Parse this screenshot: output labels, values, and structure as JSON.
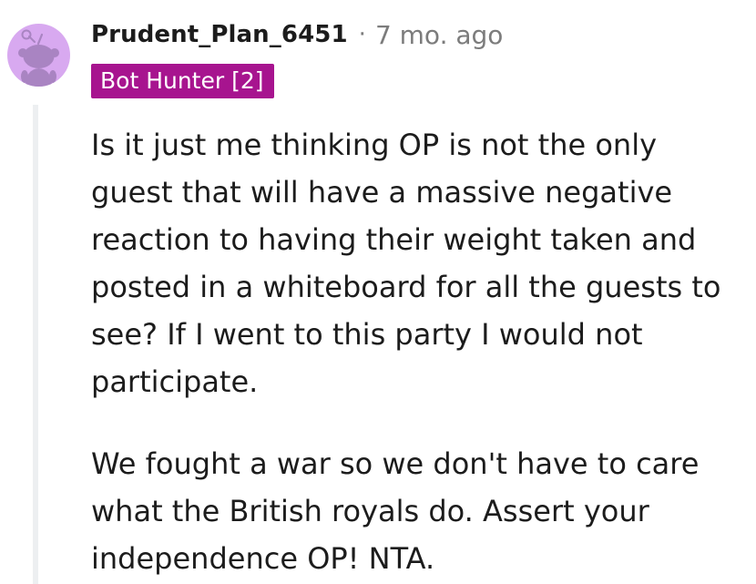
{
  "comment": {
    "author": "Prudent_Plan_6451",
    "separator": "·",
    "timestamp": "7 mo. ago",
    "flair": "Bot Hunter [2]",
    "paragraphs": [
      "Is it just me thinking OP is not the only guest that will have a massive negative reaction to having their weight taken and posted in a whiteboard for all the guests to see? If I went to this party I would not participate.",
      "We fought a war so we don't have to care what the British royals do. Assert your independence OP! NTA."
    ]
  },
  "colors": {
    "avatar_bg": "#d8a9f0",
    "avatar_figure": "#a984c2",
    "flair_bg": "#a7148f",
    "flair_text": "#ffffff",
    "thread_line": "#edeff1",
    "meta_text": "#7c7c7c",
    "body_text": "#1c1c1c"
  },
  "icons": {
    "avatar": "snoo-avatar-icon"
  }
}
